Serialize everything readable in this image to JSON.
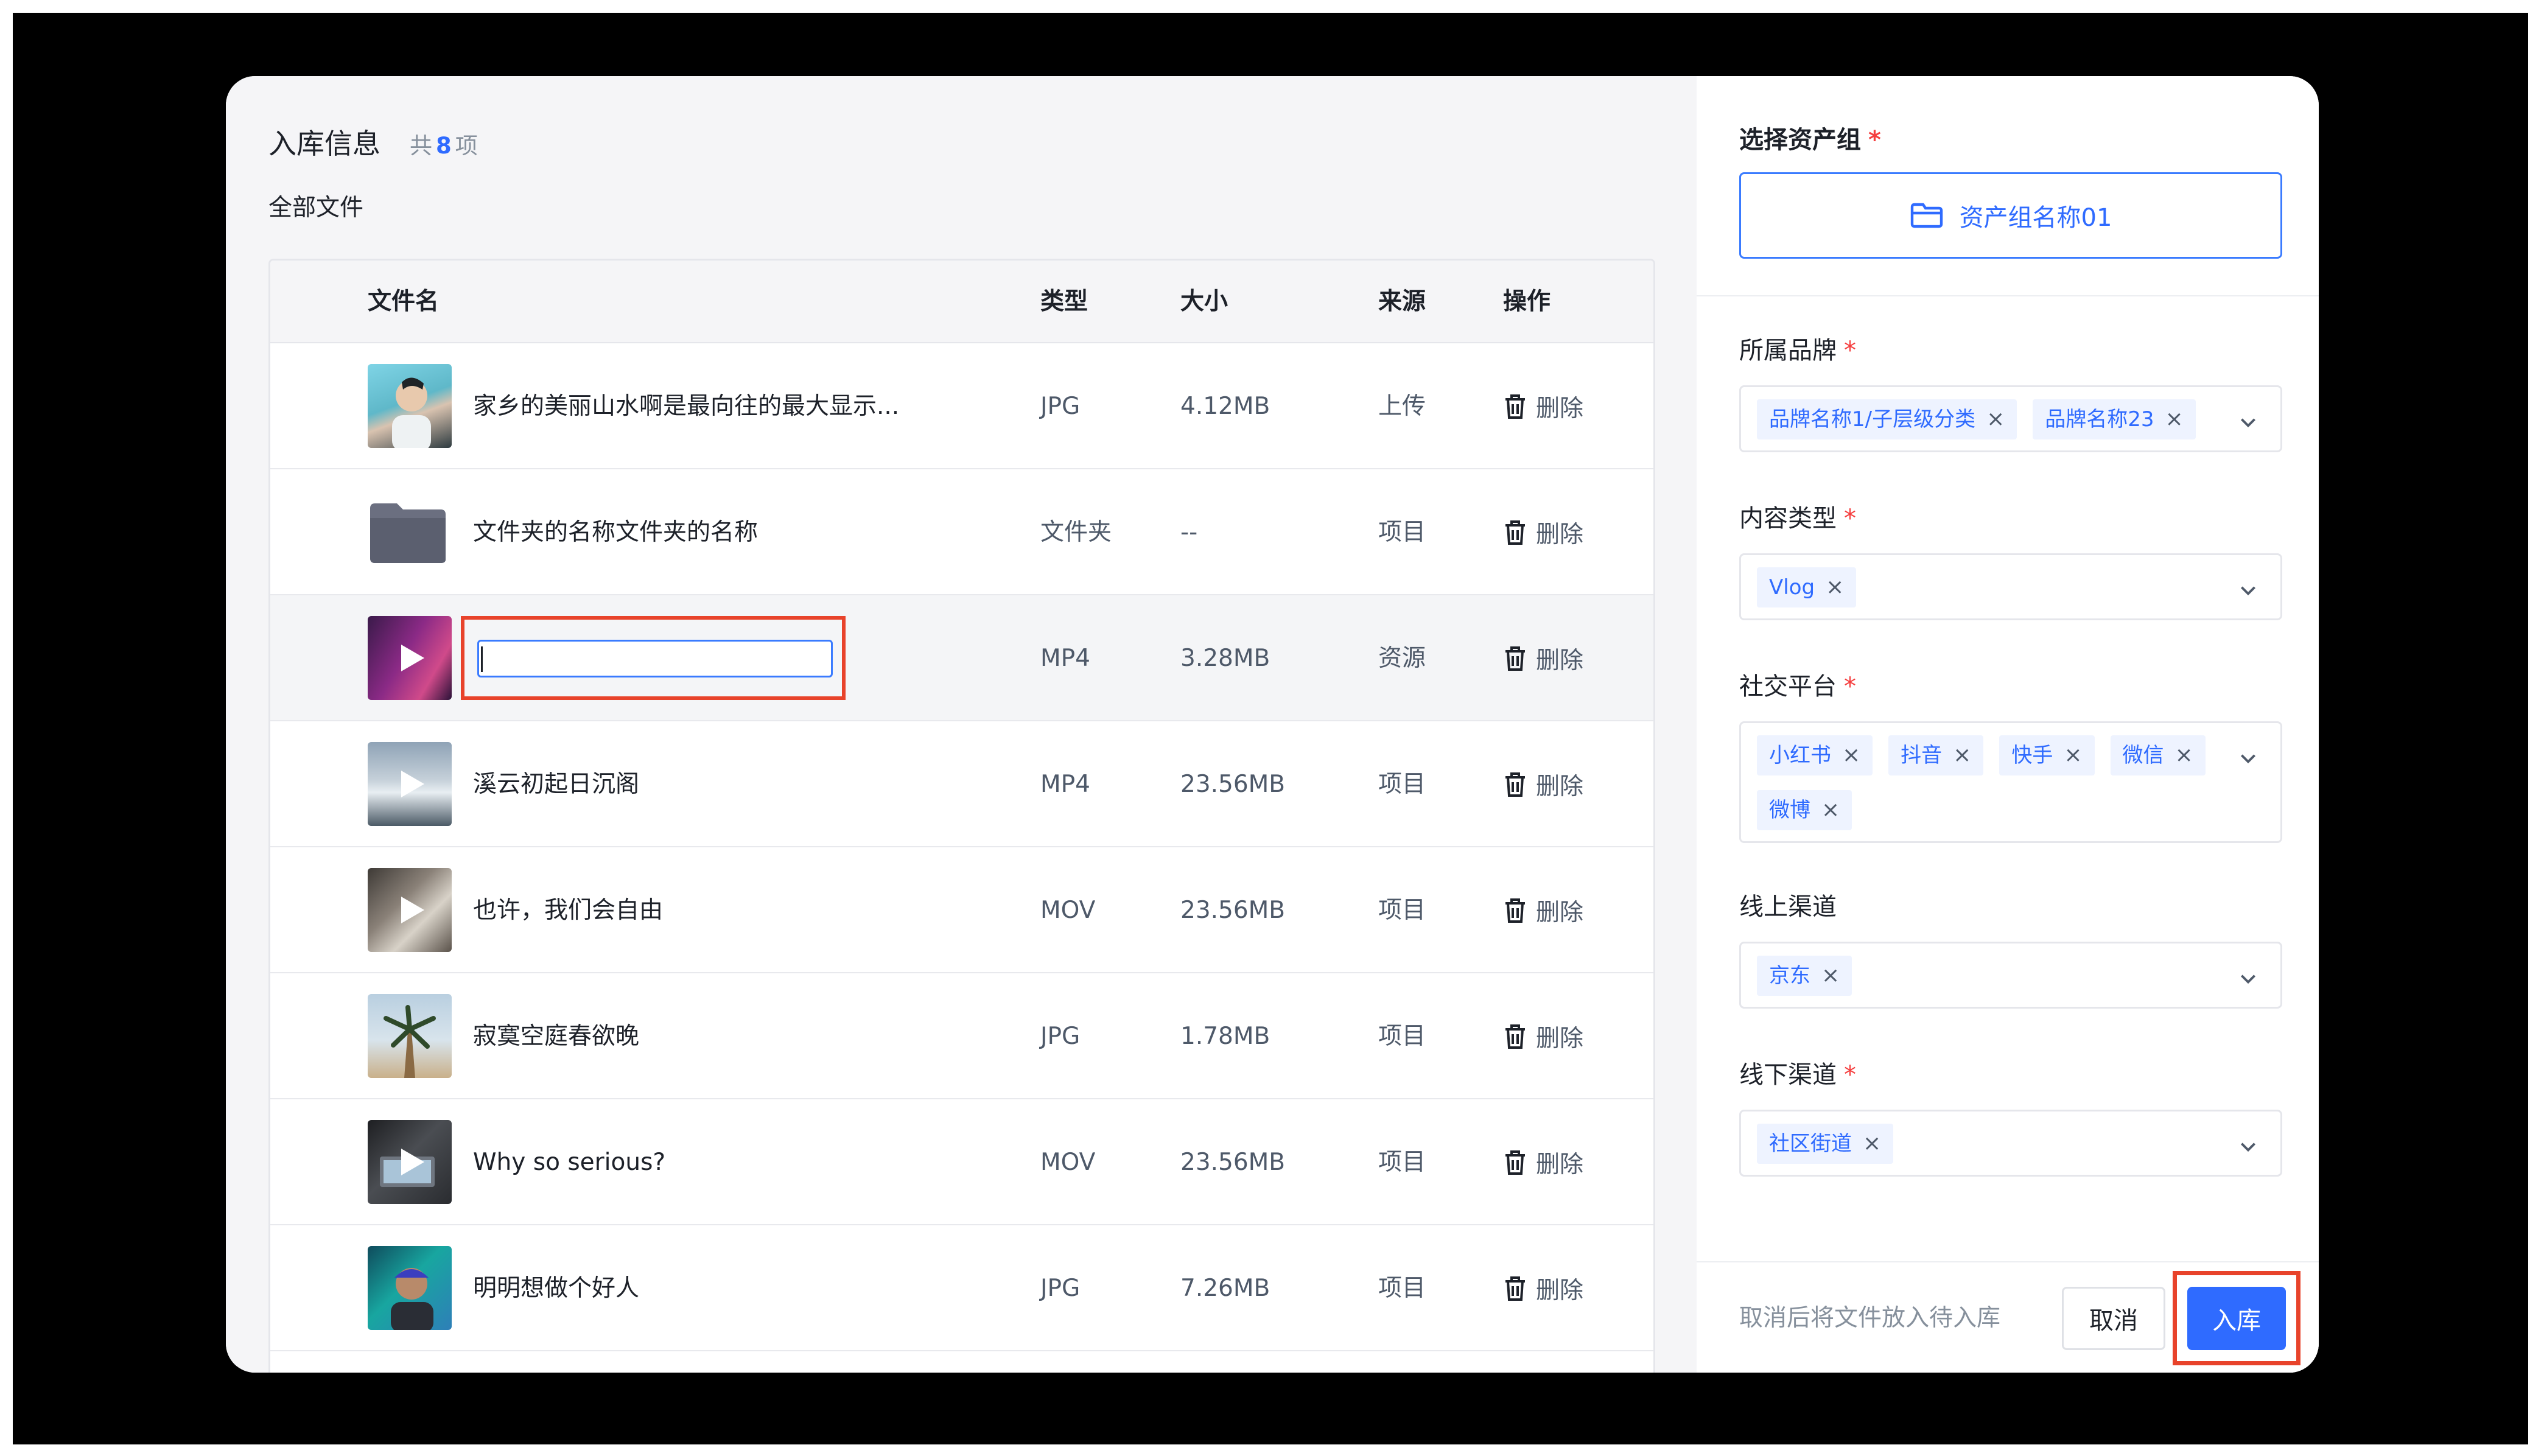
{
  "header": {
    "title": "入库信息",
    "count_prefix": "共",
    "count": "8",
    "count_suffix": "项",
    "subtitle": "全部文件"
  },
  "table": {
    "columns": [
      "文件名",
      "类型",
      "大小",
      "来源",
      "操作"
    ],
    "delete_label": "删除",
    "rows": [
      {
        "name": "家乡的美丽山水啊是最向往的最大显示...",
        "type": "JPG",
        "size": "4.12MB",
        "source": "上传",
        "thumb": "portrait-photo"
      },
      {
        "name": "文件夹的名称文件夹的名称",
        "type": "文件夹",
        "size": "--",
        "source": "项目",
        "thumb": "folder-icon"
      },
      {
        "name": "",
        "type": "MP4",
        "size": "3.28MB",
        "source": "资源",
        "thumb": "video-purple",
        "editing": true
      },
      {
        "name": "溪云初起日沉阁",
        "type": "MP4",
        "size": "23.56MB",
        "source": "项目",
        "thumb": "video-iceberg"
      },
      {
        "name": "也许，我们会自由",
        "type": "MOV",
        "size": "23.56MB",
        "source": "项目",
        "thumb": "video-room"
      },
      {
        "name": "寂寞空庭春欲晚",
        "type": "JPG",
        "size": "1.78MB",
        "source": "项目",
        "thumb": "palm-tree-photo"
      },
      {
        "name": "Why so serious?",
        "type": "MOV",
        "size": "23.56MB",
        "source": "项目",
        "thumb": "video-laptop"
      },
      {
        "name": "明明想做个好人",
        "type": "JPG",
        "size": "7.26MB",
        "source": "项目",
        "thumb": "portrait-cap"
      }
    ]
  },
  "form": {
    "asset_group": {
      "label": "选择资产组",
      "required": "*",
      "button": "资产组名称01"
    },
    "brand": {
      "label": "所属品牌",
      "required": "*",
      "tags": [
        "品牌名称1/子层级分类",
        "品牌名称23"
      ]
    },
    "content_type": {
      "label": "内容类型",
      "required": "*",
      "tags": [
        "Vlog"
      ]
    },
    "social": {
      "label": "社交平台",
      "required": "*",
      "tags": [
        "小红书",
        "抖音",
        "快手",
        "微信",
        "微博"
      ]
    },
    "online": {
      "label": "线上渠道",
      "tags": [
        "京东"
      ]
    },
    "offline": {
      "label": "线下渠道",
      "required": "*",
      "tags": [
        "社区街道"
      ]
    }
  },
  "footer": {
    "hint": "取消后将文件放入待入库",
    "cancel": "取消",
    "submit": "入库"
  },
  "colors": {
    "accent": "#2f6bff",
    "highlight_border": "#e8432b",
    "required": "#f53f3f"
  }
}
